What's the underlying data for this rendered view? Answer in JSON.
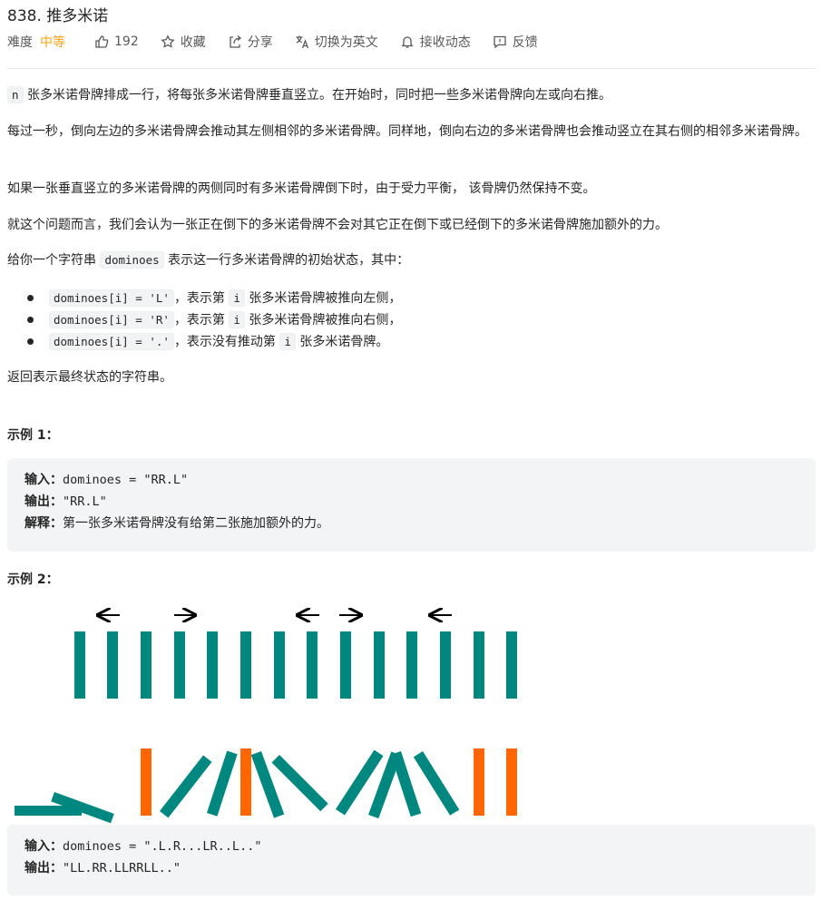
{
  "problem": {
    "title": "838. 推多米诺"
  },
  "toolbar": {
    "difficulty_label": "难度",
    "difficulty": "中等",
    "likes": "192",
    "favorite": "收藏",
    "share": "分享",
    "translate": "切换为英文",
    "subscribe": "接收动态",
    "feedback": "反馈"
  },
  "colors": {
    "accent": "#ffa116",
    "domino_teal": "#00877f",
    "domino_orange": "#ff6600"
  },
  "desc": {
    "p1_code": "n",
    "p1": "张多米诺骨牌排成一行，将每张多米诺骨牌垂直竖立。在开始时，同时把一些多米诺骨牌向左或向右推。",
    "p2": "每过一秒，倒向左边的多米诺骨牌会推动其左侧相邻的多米诺骨牌。同样地，倒向右边的多米诺骨牌也会推动竖立在其右侧的相邻多米诺骨牌。",
    "p3": "如果一张垂直竖立的多米诺骨牌的两侧同时有多米诺骨牌倒下时，由于受力平衡， 该骨牌仍然保持不变。",
    "p4": "就这个问题而言，我们会认为一张正在倒下的多米诺骨牌不会对其它正在倒下或已经倒下的多米诺骨牌施加额外的力。",
    "p5_pre": "给你一个字符串",
    "p5_code": "dominoes",
    "p5_post": "表示这一行多米诺骨牌的初始状态，其中：",
    "bullets": [
      {
        "code": "dominoes[i] = 'L'",
        "mid": "，表示第",
        "code2": "i",
        "tail": "张多米诺骨牌被推向左侧，"
      },
      {
        "code": "dominoes[i] = 'R'",
        "mid": "，表示第",
        "code2": "i",
        "tail": "张多米诺骨牌被推向右侧，"
      },
      {
        "code": "dominoes[i] = '.'",
        "mid": "，表示没有推动第",
        "code2": "i",
        "tail": "张多米诺骨牌。"
      }
    ],
    "p6": "返回表示最终状态的字符串。"
  },
  "example1": {
    "title": "示例 1：",
    "input_label": "输入：",
    "input": "dominoes = \"RR.L\"",
    "output_label": "输出：",
    "output": "\"RR.L\"",
    "explain_label": "解释：",
    "explain": "第一张多米诺骨牌没有给第二张施加额外的力。"
  },
  "example2": {
    "title": "示例 2：",
    "input_label": "输入：",
    "input": "dominoes = \".L.R...LR..L..\"",
    "output_label": "输出：",
    "output": "\"LL.RR.LLRRLL..\""
  }
}
